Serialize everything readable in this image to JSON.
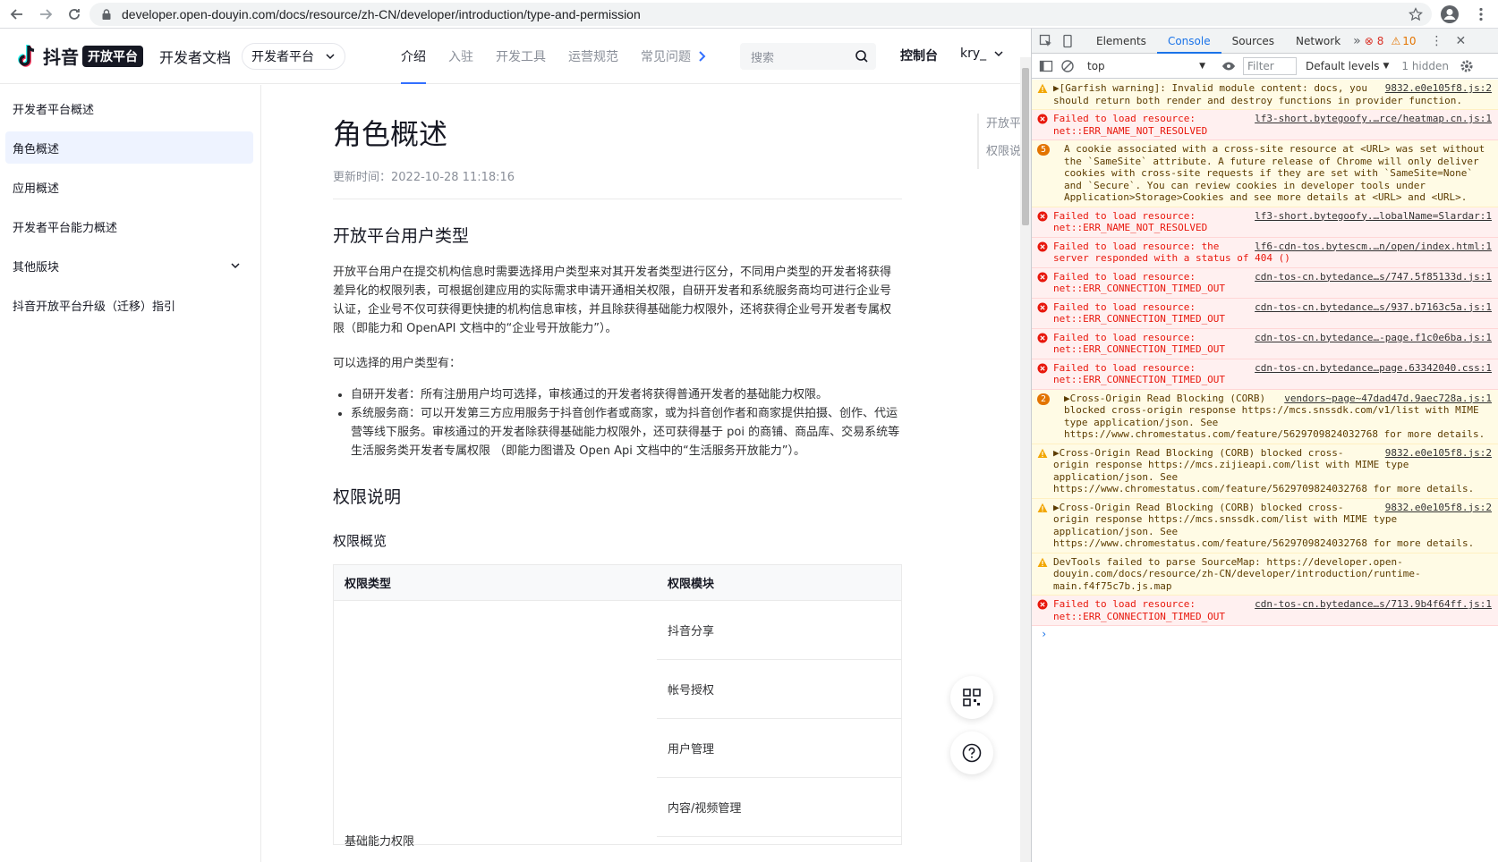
{
  "browser": {
    "url": "developer.open-douyin.com/docs/resource/zh-CN/developer/introduction/type-and-permission"
  },
  "header": {
    "logo_text": "抖音",
    "logo_badge": "开放平台",
    "doc_title": "开发者文档",
    "platform_select": "开发者平台",
    "tabs": [
      "介绍",
      "入驻",
      "开发工具",
      "运营规范",
      "常见问题"
    ],
    "search_placeholder": "搜索",
    "console_link": "控制台",
    "user": "kry_"
  },
  "sidebar": {
    "items": [
      {
        "label": "开发者平台概述"
      },
      {
        "label": "角色概述"
      },
      {
        "label": "应用概述"
      },
      {
        "label": "开发者平台能力概述"
      },
      {
        "label": "其他版块"
      },
      {
        "label": "抖音开放平台升级（迁移）指引"
      }
    ]
  },
  "article": {
    "title": "角色概述",
    "updated": "更新时间：2022-10-28 11:18:16",
    "section1_title": "开放平台用户类型",
    "section1_para": "开放平台用户在提交机构信息时需要选择用户类型来对其开发者类型进行区分，不同用户类型的开发者将获得差异化的权限列表，可根据创建应用的实际需求申请开通相关权限，自研开发者和系统服务商均可进行企业号认证，企业号不仅可获得更快捷的机构信息审核，并且除获得基础能力权限外，还将获得企业号开发者专属权限（即能力和 OpenAPI 文档中的“企业号开放能力”）。",
    "choose_label": "可以选择的用户类型有：",
    "bullets": [
      "自研开发者：所有注册用户均可选择，审核通过的开发者将获得普通开发者的基础能力权限。",
      "系统服务商：可以开发第三方应用服务于抖音创作者或商家，或为抖音创作者和商家提供拍摄、创作、代运营等线下服务。审核通过的开发者除获得基础能力权限外，还可获得基于 poi 的商铺、商品库、交易系统等生活服务类开发者专属权限 （即能力图谱及 Open Api 文档中的“生活服务开放能力”）。"
    ],
    "section2_title": "权限说明",
    "subsection_title": "权限概览",
    "table": {
      "headers": [
        "权限类型",
        "权限模块"
      ],
      "modules": [
        "抖音分享",
        "帐号授权",
        "用户管理",
        "内容/视频管理"
      ],
      "category": "基础能力权限"
    }
  },
  "toc": [
    "开放平台",
    "权限说明"
  ],
  "devtools": {
    "tabs": [
      "Elements",
      "Console",
      "Sources",
      "Network"
    ],
    "error_count": "8",
    "warn_count": "10",
    "context": "top",
    "filter_placeholder": "Filter",
    "levels": "Default levels",
    "hidden": "1 hidden",
    "messages": [
      {
        "type": "warn",
        "text": "▶[Garfish warning]:  Invalid module content: docs, you should return both render and destroy functions in provider function.",
        "src": "9832.e0e105f8.js:2"
      },
      {
        "type": "error",
        "text": "Failed to load resource: net::ERR_NAME_NOT_RESOLVED",
        "src": "lf3-short.bytegoofy.…rce/heatmap.cn.js:1"
      },
      {
        "type": "warn-badge",
        "badge": "5",
        "text": "A cookie associated with a cross-site resource at <URL> was set without the `SameSite` attribute. A future release of Chrome will only deliver cookies with cross-site requests if they are set with `SameSite=None` and `Secure`. You can review cookies in developer tools under Application>Storage>Cookies and see more details at <URL> and <URL>.",
        "src": ""
      },
      {
        "type": "error",
        "text": "Failed to load resource: net::ERR_NAME_NOT_RESOLVED",
        "src": "lf3-short.bytegoofy.…lobalName=Slardar:1"
      },
      {
        "type": "error",
        "text": "Failed to load resource: the server responded with a status of 404 ()",
        "src": "lf6-cdn-tos.bytescm.…n/open/index.html:1"
      },
      {
        "type": "error",
        "text": "Failed to load resource: net::ERR_CONNECTION_TIMED_OUT",
        "src": "cdn-tos-cn.bytedance…s/747.5f85133d.js:1"
      },
      {
        "type": "error",
        "text": "Failed to load resource: net::ERR_CONNECTION_TIMED_OUT",
        "src": "cdn-tos-cn.bytedance…s/937.b7163c5a.js:1"
      },
      {
        "type": "error",
        "text": "Failed to load resource: net::ERR_CONNECTION_TIMED_OUT",
        "src": "cdn-tos-cn.bytedance…-page.f1c0e6ba.js:1"
      },
      {
        "type": "error",
        "text": "Failed to load resource: net::ERR_CONNECTION_TIMED_OUT",
        "src": "cdn-tos-cn.bytedance…page.63342040.css:1"
      },
      {
        "type": "warn-badge",
        "badge": "2",
        "text": "▶Cross-Origin Read Blocking (CORB) blocked cross-origin response https://mcs.snssdk.com/v1/list with MIME type application/json. See https://www.chromestatus.com/feature/5629709824032768 for more details.",
        "src": "vendors~page~47dad47d.9aec728a.js:1"
      },
      {
        "type": "warn",
        "text": "▶Cross-Origin Read Blocking (CORB) blocked cross-origin response https://mcs.zijieapi.com/list with MIME type application/json. See https://www.chromestatus.com/feature/5629709824032768 for more details.",
        "src": "9832.e0e105f8.js:2"
      },
      {
        "type": "warn",
        "text": "▶Cross-Origin Read Blocking (CORB) blocked cross-origin response https://mcs.snssdk.com/list with MIME type application/json. See https://www.chromestatus.com/feature/5629709824032768 for more details.",
        "src": "9832.e0e105f8.js:2"
      },
      {
        "type": "warn",
        "text": "DevTools failed to parse SourceMap: https://developer.open-douyin.com/docs/resource/zh-CN/developer/introduction/runtime-main.f4f75c7b.js.map",
        "src": ""
      },
      {
        "type": "error",
        "text": "Failed to load resource: net::ERR_CONNECTION_TIMED_OUT",
        "src": "cdn-tos-cn.bytedance…s/713.9b4f64ff.js:1"
      }
    ],
    "prompt": "›"
  },
  "colors": {
    "accent": "#3370ff",
    "active_bg": "#eef3ff",
    "error": "#d93025",
    "warn": "#e37400"
  }
}
